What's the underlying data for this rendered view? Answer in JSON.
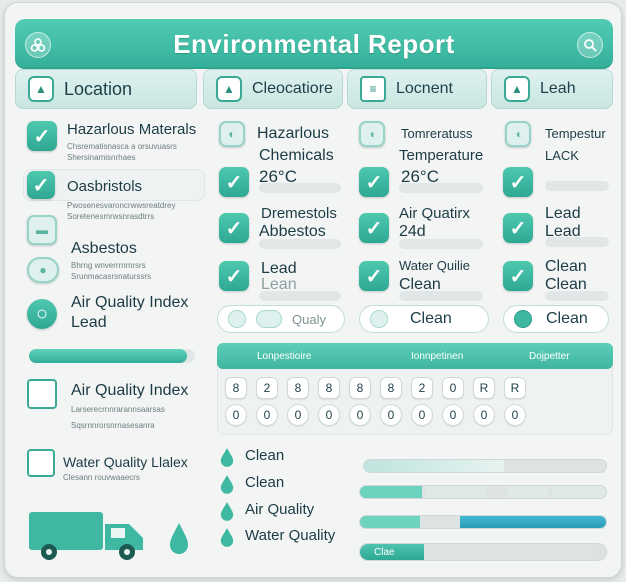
{
  "header": {
    "title": "Environmental Report"
  },
  "tabs": [
    {
      "label": "Location"
    },
    {
      "label": "Cleocatiore"
    },
    {
      "label": "Locnent"
    },
    {
      "label": "Leah"
    }
  ],
  "left_panel": {
    "hazardous": {
      "title": "Hazarlous Materals",
      "sub1": "Chsrematisnasca a orsuvuasrs",
      "sub2": "Shersinamisnrhaes"
    },
    "oasbristols": {
      "title": "Oasbristols",
      "sub1": "Pwosenesvaroncrwwsreatdrey",
      "sub2": "Soretenesmrwsnrasdtrrs"
    },
    "asbestos": {
      "title": "Asbestos",
      "sub1": "Bhrng wnverrrnmrsrs",
      "sub2": "Srunmacasrsnaturssrs"
    },
    "aqi1": {
      "line1": "Air Quality Index",
      "line2": "Lead"
    },
    "aqi2": {
      "title": "Air Quality Index",
      "sub1": "Larserecrnnrarannsaarsas",
      "sub2": "Sqsrnnrorsnrnasesanra"
    },
    "water": {
      "title": "Water Quality Llalex",
      "sub1": "Clesann rouvwaaecrs"
    }
  },
  "middle_col": {
    "haz_line1": "Hazarlous",
    "haz_line2": "Chemicals",
    "haz_temp": "26°C",
    "dremes_line1": "Dremestols",
    "dremes_line2": "Abbestos",
    "lead_line1": "Lead",
    "lead_line2": "Lean",
    "pill": "Qualy"
  },
  "right_col_a": {
    "temp_line1": "Tomreratuss",
    "temp_line2": "Temperature",
    "temp_val": "26°C",
    "aq_line1": "Air Quatirx",
    "aq_line2": "24d",
    "wq_line1": "Water Quilie",
    "wq_line2": "Clean",
    "pill": "Clean"
  },
  "right_col_b": {
    "temp_line1": "Tempestur",
    "temp_line2": "LACK",
    "lead_line1": "Lead",
    "lead_line2": "Lead",
    "clean_line1": "Clean",
    "clean_line2": "Clean",
    "pill": "Clean"
  },
  "keypad": {
    "headers": [
      "Lonpestioire",
      "Ionnpetinen",
      "Dojpetter"
    ],
    "row1": [
      "8",
      "2",
      "8",
      "8",
      "8",
      "8",
      "2",
      "0",
      "R",
      "R"
    ],
    "row2": [
      "0",
      "0",
      "0",
      "0",
      "0",
      "0",
      "0",
      "0",
      "0",
      "0"
    ]
  },
  "bottom_list": [
    {
      "label": "Clean"
    },
    {
      "label": "Clean"
    },
    {
      "label": "Air Quality"
    },
    {
      "label": "Water Quality"
    }
  ],
  "bottom_slider_label": "Clae",
  "progress": {
    "left_bar": 0.95
  },
  "colors": {
    "accent": "#3fb8a1",
    "accent_dark": "#2b9c88",
    "bg": "#f3f5f5",
    "text": "#1c3b45"
  }
}
